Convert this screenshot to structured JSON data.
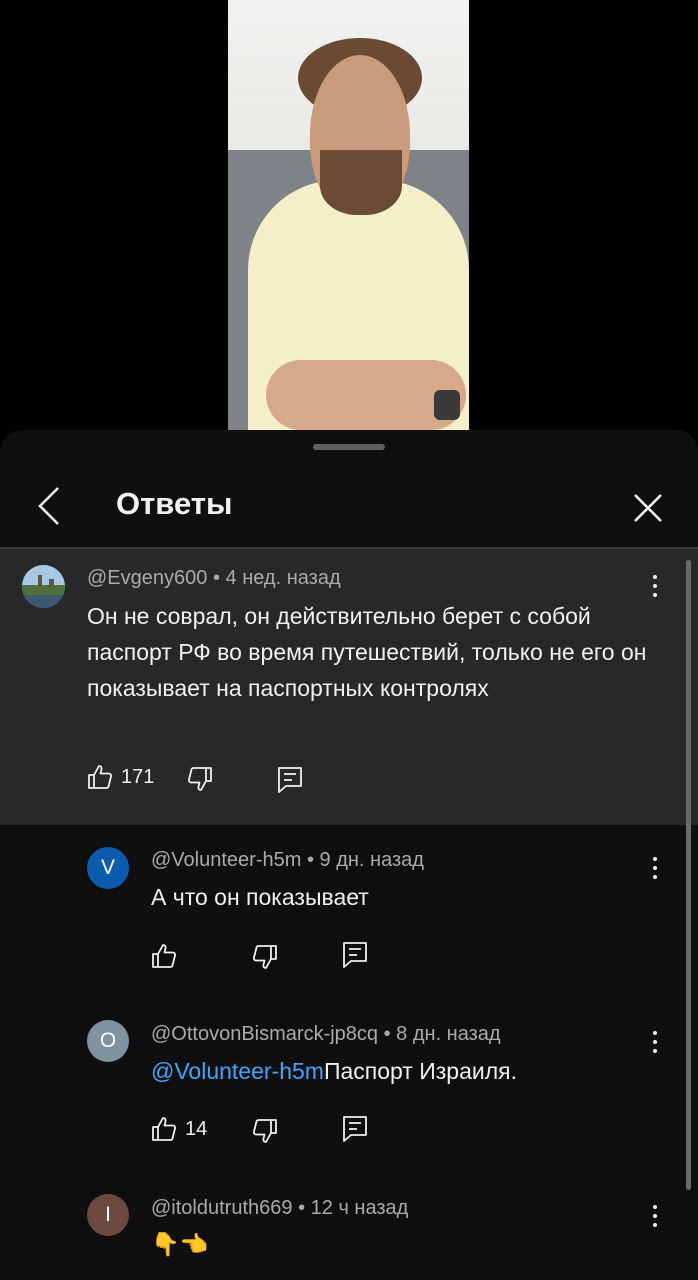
{
  "sheet": {
    "title": "Ответы"
  },
  "parent_comment": {
    "author": "@Evgeny600",
    "time": "4 нед. назад",
    "text": "Он не соврал, он действительно берет с собой паспорт РФ во время путешествий, только не его он показывает на паспортных контролях",
    "likes": "171"
  },
  "replies": [
    {
      "avatar_letter": "V",
      "avatar_color": "#0b5cad",
      "author": "@Volunteer-h5m",
      "time": "9 дн. назад",
      "text": "А что он показывает",
      "likes": ""
    },
    {
      "avatar_letter": "O",
      "avatar_color": "#7f93a1",
      "author": "@OttovonBismarck-jp8cq",
      "time": "8 дн. назад",
      "mention": "@Volunteer-h5m",
      "text": "Паспорт Израиля.",
      "likes": "14"
    },
    {
      "avatar_letter": "I",
      "avatar_color": "#6d4a3f",
      "author": "@itoldutruth669",
      "time": "12 ч назад",
      "text": "👇👈",
      "likes": ""
    }
  ],
  "separator": " • ",
  "colors": {
    "accent_link": "#3ea6ff",
    "sheet_bg": "#0f0f0f",
    "highlight_bg": "#282828"
  },
  "icons": {
    "back": "chevron-left-icon",
    "close": "close-icon",
    "like": "thumb-up-icon",
    "dislike": "thumb-down-icon",
    "reply": "reply-icon",
    "more": "more-vert-icon"
  }
}
